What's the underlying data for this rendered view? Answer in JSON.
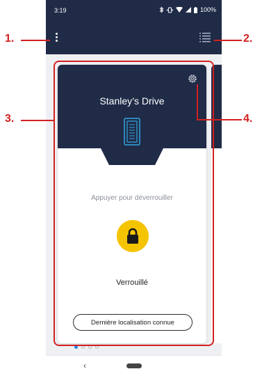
{
  "status_bar": {
    "time": "3:19",
    "battery": "100%"
  },
  "card": {
    "title": "Stanley’s Drive",
    "hint": "Appuyer pour déverrouiller",
    "lock_state": "Verrouillé",
    "location_button": "Dernière localisation connue"
  },
  "pager": {
    "count": 4,
    "active_index": 0
  },
  "annotations": [
    "1.",
    "2.",
    "3.",
    "4."
  ],
  "colors": {
    "header": "#1f2b47",
    "accent": "#f5c400",
    "annotation": "#d32020",
    "active_dot": "#1e88e5"
  },
  "icons": {
    "menu": "kebab-menu-icon",
    "list": "list-icon",
    "settings": "gear-icon",
    "device": "device-icon",
    "lock": "padlock-icon",
    "bluetooth": "bluetooth-icon",
    "wifi": "wifi-icon",
    "signal": "signal-icon",
    "battery": "battery-icon"
  }
}
